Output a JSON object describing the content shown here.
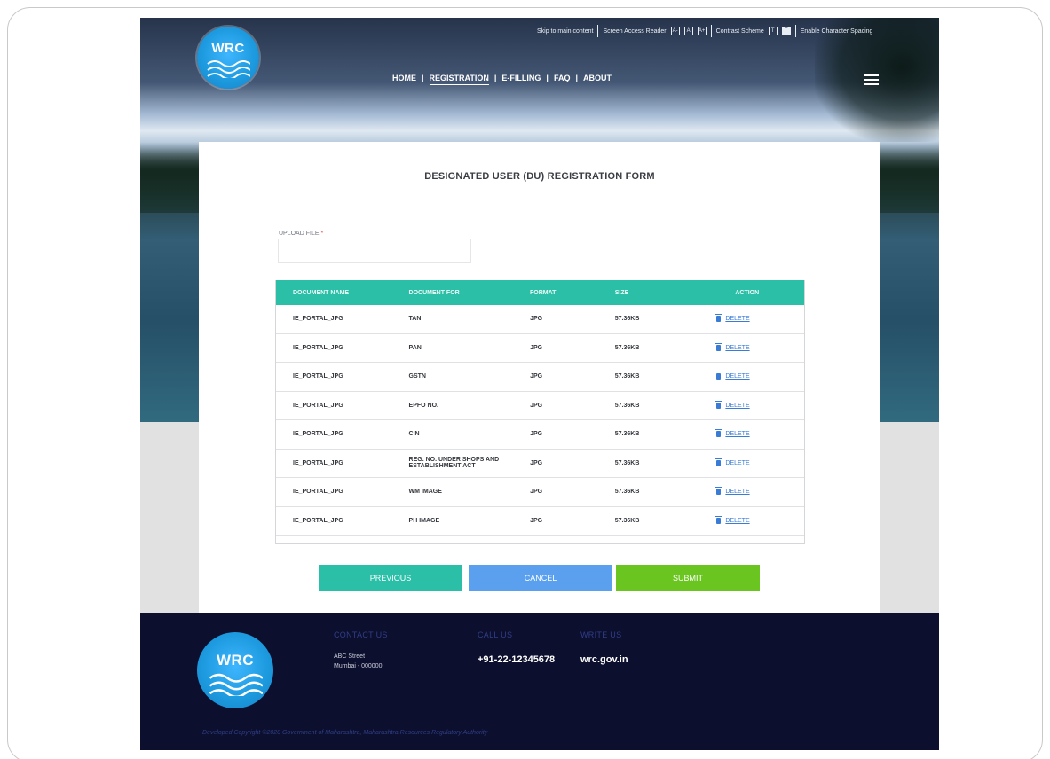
{
  "accessibility": {
    "skip_link": "Skip to main content",
    "screen_reader": "Screen Access Reader",
    "font_sizes": [
      "A-",
      "A",
      "A+"
    ],
    "contrast_label": "Contrast Scheme",
    "contrast_options": [
      "T",
      "T"
    ],
    "spacing_label": "Enable Character Spacing"
  },
  "logo": {
    "text": "WRC"
  },
  "nav": {
    "items": [
      {
        "label": "HOME"
      },
      {
        "label": "REGISTRATION"
      },
      {
        "label": "E-FILLING"
      },
      {
        "label": "FAQ"
      },
      {
        "label": "ABOUT"
      }
    ],
    "separator": "|"
  },
  "form": {
    "title": "DESIGNATED USER (DU) REGISTRATION FORM",
    "upload_label": "UPLOAD FILE",
    "required_mark": "*",
    "upload_value": ""
  },
  "table": {
    "headers": [
      "DOCUMENT NAME",
      "DOCUMENT FOR",
      "FORMAT",
      "SIZE",
      "ACTION"
    ],
    "rows": [
      {
        "name": "IE_PORTAL_JPG",
        "doc_for": "TAN",
        "format": "JPG",
        "size": "57.36KB",
        "action": "DELETE"
      },
      {
        "name": "IE_PORTAL_JPG",
        "doc_for": "PAN",
        "format": "JPG",
        "size": "57.36KB",
        "action": "DELETE"
      },
      {
        "name": "IE_PORTAL_JPG",
        "doc_for": "GSTN",
        "format": "JPG",
        "size": "57.36KB",
        "action": "DELETE"
      },
      {
        "name": "IE_PORTAL_JPG",
        "doc_for": "EPFO NO.",
        "format": "JPG",
        "size": "57.36KB",
        "action": "DELETE"
      },
      {
        "name": "IE_PORTAL_JPG",
        "doc_for": "CIN",
        "format": "JPG",
        "size": "57.36KB",
        "action": "DELETE"
      },
      {
        "name": "IE_PORTAL_JPG",
        "doc_for": "REG. NO. UNDER SHOPS AND ESTABLISHMENT ACT",
        "format": "JPG",
        "size": "57.36KB",
        "action": "DELETE"
      },
      {
        "name": "IE_PORTAL_JPG",
        "doc_for": "WM IMAGE",
        "format": "JPG",
        "size": "57.36KB",
        "action": "DELETE"
      },
      {
        "name": "IE_PORTAL_JPG",
        "doc_for": "PH IMAGE",
        "format": "JPG",
        "size": "57.36KB",
        "action": "DELETE"
      }
    ]
  },
  "buttons": {
    "previous": "PREVIOUS",
    "cancel": "CANCEL",
    "submit": "SUBMIT"
  },
  "footer": {
    "contact_heading": "CONTACT US",
    "address_line1": "ABC Street",
    "address_line2": "Mumbai - 000000",
    "call_heading": "CALL US",
    "phone": "+91-22-12345678",
    "write_heading": "WRITE US",
    "website": "wrc.gov.in",
    "copyright": "Developed Copyright ©2020 Government of Maharashtra, Maharashtra Resources Regulatory Authority"
  },
  "colors": {
    "accent_teal": "#2cbfa7",
    "cancel_blue": "#5aa0ee",
    "submit_green": "#6bc520",
    "footer_navy": "#0d0f2e",
    "link_blue": "#3a7bd5"
  }
}
